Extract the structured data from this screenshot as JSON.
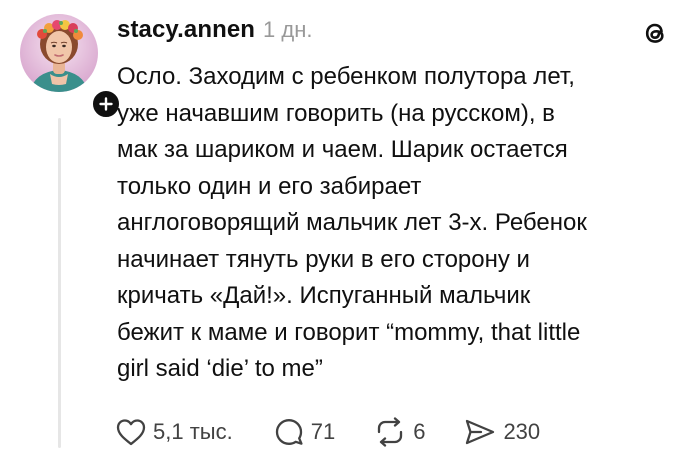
{
  "post": {
    "username": "stacy.annen",
    "timestamp": "1 дн.",
    "text_lines": [
      "Осло. Заходим с ребенком полутора лет,",
      "уже начавшим говорить (на русском), в",
      "мак за шариком и чаем. Шарик остается",
      "только один и его забирает",
      "англоговорящий мальчик лет 3-х. Ребенок",
      "начинает тянуть руки в его сторону и",
      "кричать «Дай!». Испуганный мальчик",
      "бежит к маме и говорит “mommy, that little",
      "girl said ‘die’ to me”"
    ],
    "stats": {
      "likes": "5,1 тыс.",
      "replies": "71",
      "reposts": "6",
      "shares": "230"
    }
  },
  "icons": {
    "avatar": "user-avatar",
    "follow": "plus-icon",
    "logo": "threads-logo-icon",
    "like": "heart-icon",
    "reply": "comment-bubble-icon",
    "repost": "repost-arrows-icon",
    "share": "send-arrow-icon"
  },
  "colors": {
    "text": "#101010",
    "muted": "#999999",
    "icon": "#424242",
    "thread_line": "#e6e6e6"
  }
}
